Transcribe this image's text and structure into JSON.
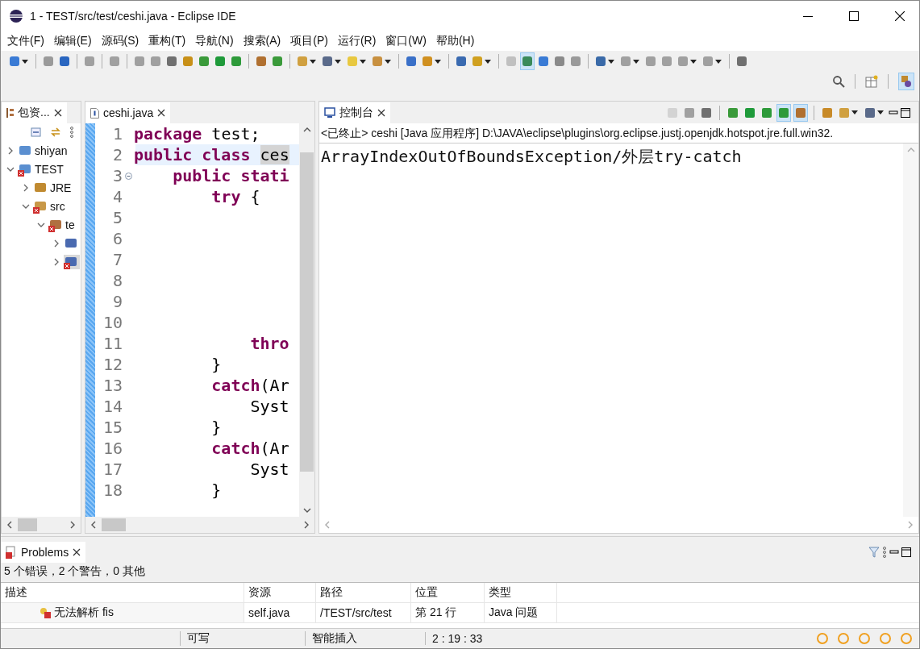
{
  "window": {
    "title": "1 - TEST/src/test/ceshi.java - Eclipse IDE"
  },
  "menu": [
    "文件(F)",
    "编辑(E)",
    "源码(S)",
    "重构(T)",
    "导航(N)",
    "搜索(A)",
    "项目(P)",
    "运行(R)",
    "窗口(W)",
    "帮助(H)"
  ],
  "toolbar": {
    "buttons": [
      {
        "kind": "button",
        "on": false,
        "dropdown": true
      },
      {
        "kind": "separator"
      },
      {
        "kind": "button",
        "on": false,
        "dropdown": false
      },
      {
        "kind": "button",
        "on": false,
        "dropdown": false
      },
      {
        "kind": "separator"
      },
      {
        "kind": "button",
        "on": false,
        "dropdown": false
      },
      {
        "kind": "separator"
      },
      {
        "kind": "button",
        "on": false,
        "dropdown": false
      },
      {
        "kind": "separator"
      },
      {
        "kind": "button",
        "on": false,
        "dropdown": false
      },
      {
        "kind": "button",
        "on": false,
        "dropdown": false
      },
      {
        "kind": "button",
        "on": false,
        "dropdown": false
      },
      {
        "kind": "button",
        "on": false,
        "dropdown": false
      },
      {
        "kind": "button",
        "on": false,
        "dropdown": false
      },
      {
        "kind": "button",
        "on": false,
        "dropdown": false
      },
      {
        "kind": "button",
        "on": false,
        "dropdown": false
      },
      {
        "kind": "separator"
      },
      {
        "kind": "button",
        "on": false,
        "dropdown": false
      },
      {
        "kind": "button",
        "on": false,
        "dropdown": false
      },
      {
        "kind": "separator"
      },
      {
        "kind": "button",
        "on": false,
        "dropdown": true
      },
      {
        "kind": "button",
        "on": false,
        "dropdown": true
      },
      {
        "kind": "button",
        "on": false,
        "dropdown": true
      },
      {
        "kind": "button",
        "on": false,
        "dropdown": true
      },
      {
        "kind": "separator"
      },
      {
        "kind": "button",
        "on": false,
        "dropdown": false
      },
      {
        "kind": "button",
        "on": false,
        "dropdown": true
      },
      {
        "kind": "separator"
      },
      {
        "kind": "button",
        "on": false,
        "dropdown": false
      },
      {
        "kind": "button",
        "on": false,
        "dropdown": true
      },
      {
        "kind": "separator"
      },
      {
        "kind": "button",
        "on": false,
        "dropdown": false
      },
      {
        "kind": "button",
        "on": true,
        "dropdown": false
      },
      {
        "kind": "button",
        "on": false,
        "dropdown": false
      },
      {
        "kind": "button",
        "on": false,
        "dropdown": false
      },
      {
        "kind": "button",
        "on": false,
        "dropdown": false
      },
      {
        "kind": "separator"
      },
      {
        "kind": "button",
        "on": false,
        "dropdown": true
      },
      {
        "kind": "button",
        "on": false,
        "dropdown": true
      },
      {
        "kind": "button",
        "on": false,
        "dropdown": false
      },
      {
        "kind": "button",
        "on": false,
        "dropdown": false
      },
      {
        "kind": "button",
        "on": false,
        "dropdown": true
      },
      {
        "kind": "button",
        "on": false,
        "dropdown": true
      },
      {
        "kind": "separator"
      },
      {
        "kind": "button",
        "on": false,
        "dropdown": false
      }
    ]
  },
  "perspectives": [
    {
      "selected": true
    }
  ],
  "package_explorer": {
    "tab": "包资...",
    "tree": [
      {
        "kind": "project",
        "label": "shiyan",
        "expanded": false,
        "error": false,
        "selected": false
      },
      {
        "kind": "project",
        "label": "TEST",
        "expanded": true,
        "error": true,
        "selected": false,
        "children": [
          {
            "kind": "library",
            "label": "JRE",
            "expanded": false,
            "error": false,
            "selected": false
          },
          {
            "kind": "folder",
            "label": "src",
            "expanded": true,
            "error": true,
            "selected": false,
            "children": [
              {
                "kind": "package",
                "label": "te",
                "expanded": true,
                "error": true,
                "selected": false,
                "children": [
                  {
                    "kind": "file",
                    "expanded": false,
                    "error": false,
                    "selected": false
                  },
                  {
                    "kind": "file",
                    "expanded": false,
                    "error": true,
                    "selected": true
                  }
                ]
              }
            ]
          }
        ]
      }
    ]
  },
  "editor": {
    "tab": "ceshi.java",
    "lines": [
      {
        "number": "1",
        "current": false,
        "fold": false,
        "tokens": [
          {
            "kind": "keyword",
            "text": "package"
          },
          {
            "kind": "plain",
            "text": " test;"
          }
        ]
      },
      {
        "number": "2",
        "current": true,
        "fold": false,
        "tokens": [
          {
            "kind": "keyword",
            "text": "public class "
          },
          {
            "kind": "occurrence",
            "text": "ces"
          }
        ]
      },
      {
        "number": "3",
        "current": false,
        "fold": true,
        "tokens": [
          {
            "kind": "keyword",
            "text": "    public stati"
          }
        ]
      },
      {
        "number": "4",
        "current": false,
        "fold": false,
        "tokens": [
          {
            "kind": "keyword",
            "text": "        try"
          },
          {
            "kind": "plain",
            "text": " {"
          }
        ]
      },
      {
        "number": "5",
        "current": false,
        "fold": false
      },
      {
        "number": "6",
        "current": false,
        "fold": false
      },
      {
        "number": "7",
        "current": false,
        "fold": false
      },
      {
        "number": "8",
        "current": false,
        "fold": false
      },
      {
        "number": "9",
        "current": false,
        "fold": false
      },
      {
        "number": "10",
        "current": false,
        "fold": false
      },
      {
        "number": "11",
        "current": false,
        "fold": false,
        "tokens": [
          {
            "kind": "keyword",
            "text": "            thro"
          }
        ]
      },
      {
        "number": "12",
        "current": false,
        "fold": false,
        "tokens": [
          {
            "kind": "plain",
            "text": "        }"
          }
        ]
      },
      {
        "number": "13",
        "current": false,
        "fold": false,
        "tokens": [
          {
            "kind": "keyword",
            "text": "        catch"
          },
          {
            "kind": "plain",
            "text": "(Ar"
          }
        ]
      },
      {
        "number": "14",
        "current": false,
        "fold": false,
        "tokens": [
          {
            "kind": "plain",
            "text": "            Syst"
          }
        ]
      },
      {
        "number": "15",
        "current": false,
        "fold": false,
        "tokens": [
          {
            "kind": "plain",
            "text": "        }"
          }
        ]
      },
      {
        "number": "16",
        "current": false,
        "fold": false,
        "tokens": [
          {
            "kind": "keyword",
            "text": "        catch"
          },
          {
            "kind": "plain",
            "text": "(Ar"
          }
        ]
      },
      {
        "number": "17",
        "current": false,
        "fold": false,
        "tokens": [
          {
            "kind": "plain",
            "text": "            Syst"
          }
        ]
      },
      {
        "number": "18",
        "current": false,
        "fold": false,
        "tokens": [
          {
            "kind": "plain",
            "text": "        }"
          }
        ]
      }
    ]
  },
  "console": {
    "tab": "控制台",
    "toolbar": [
      {
        "kind": "button",
        "on": false,
        "disabled": true,
        "dropdown": false
      },
      {
        "kind": "button",
        "on": false,
        "disabled": false,
        "dropdown": false
      },
      {
        "kind": "button",
        "on": false,
        "disabled": false,
        "dropdown": false
      },
      {
        "kind": "separator"
      },
      {
        "kind": "button",
        "on": false,
        "disabled": false,
        "dropdown": false
      },
      {
        "kind": "button",
        "on": false,
        "disabled": false,
        "dropdown": false
      },
      {
        "kind": "button",
        "on": false,
        "disabled": false,
        "dropdown": false
      },
      {
        "kind": "button",
        "on": true,
        "disabled": false,
        "dropdown": false
      },
      {
        "kind": "button",
        "on": true,
        "disabled": false,
        "dropdown": false
      },
      {
        "kind": "separator"
      },
      {
        "kind": "button",
        "on": false,
        "disabled": false,
        "dropdown": false
      },
      {
        "kind": "button",
        "on": false,
        "disabled": false,
        "dropdown": true
      },
      {
        "kind": "button",
        "on": false,
        "disabled": false,
        "dropdown": true
      }
    ],
    "header": "<已终止> ceshi [Java 应用程序] D:\\JAVA\\eclipse\\plugins\\org.eclipse.justj.openjdk.hotspot.jre.full.win32.",
    "output": [
      {
        "kind": "text",
        "text": "ArrayIndexOutOfBoundsException/"
      },
      {
        "kind": "cjk",
        "text": "外层"
      },
      {
        "kind": "text",
        "text": "try-catch"
      }
    ]
  },
  "problems": {
    "tab": "Problems",
    "summary": "5 个错误，2 个警告，0 其他",
    "columns": [
      "描述",
      "资源",
      "路径",
      "位置",
      "类型"
    ],
    "rows": [
      {
        "cells": [
          "无法解析 fis",
          "self.java",
          "/TEST/src/test",
          "第 21 行",
          "Java 问题"
        ],
        "kind": "error"
      }
    ]
  },
  "status_bar": {
    "fields": [
      "可写",
      "智能插入",
      "2 : 19 : 33"
    ]
  }
}
